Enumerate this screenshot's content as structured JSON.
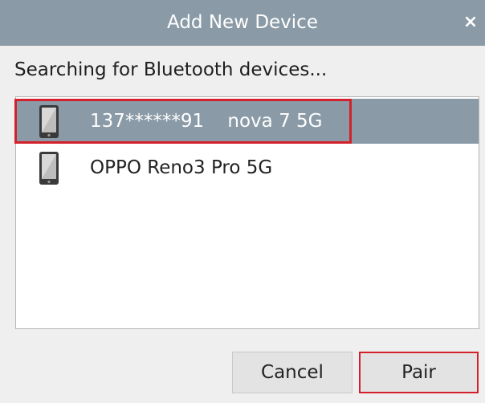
{
  "dialog": {
    "title": "Add New Device",
    "close_glyph": "×",
    "status_text": "Searching for Bluetooth devices...",
    "devices": [
      {
        "label": "137******91    nova 7 5G",
        "icon": "phone-icon",
        "selected": true
      },
      {
        "label": "OPPO Reno3 Pro 5G",
        "icon": "phone-icon",
        "selected": false
      }
    ],
    "buttons": {
      "cancel_label": "Cancel",
      "pair_label": "Pair"
    }
  },
  "colors": {
    "titlebar": "#8a9aa6",
    "selection": "#8a9aa6",
    "highlight": "#d4202a"
  }
}
